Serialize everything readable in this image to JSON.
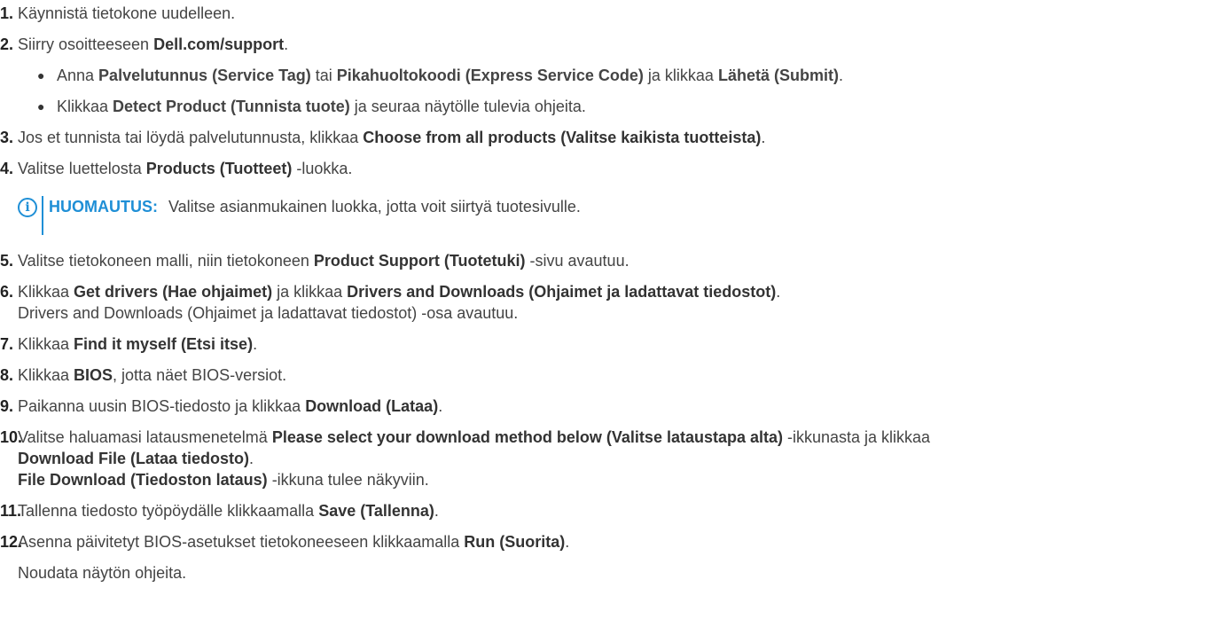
{
  "steps": [
    {
      "n": "1.",
      "parts": [
        {
          "t": "Käynnistä tietokone uudelleen."
        }
      ]
    },
    {
      "n": "2.",
      "parts": [
        {
          "t": "Siirry osoitteeseen "
        },
        {
          "t": "Dell.com/support",
          "b": true
        },
        {
          "t": "."
        }
      ]
    },
    {
      "n": "3.",
      "parts": [
        {
          "t": "Jos et tunnista tai löydä palvelutunnusta, klikkaa "
        },
        {
          "t": "Choose from all products (Valitse kaikista tuotteista)",
          "b": true
        },
        {
          "t": "."
        }
      ]
    },
    {
      "n": "4.",
      "parts": [
        {
          "t": "Valitse luettelosta "
        },
        {
          "t": "Products (Tuotteet)",
          "b": true
        },
        {
          "t": " -luokka."
        }
      ]
    },
    {
      "n": "5.",
      "parts": [
        {
          "t": "Valitse tietokoneen malli, niin tietokoneen "
        },
        {
          "t": "Product Support (Tuotetuki)",
          "b": true
        },
        {
          "t": " -sivu avautuu."
        }
      ]
    },
    {
      "n": "6.",
      "parts": [
        {
          "t": "Klikkaa "
        },
        {
          "t": "Get drivers (Hae ohjaimet)",
          "b": true
        },
        {
          "t": " ja klikkaa "
        },
        {
          "t": "Drivers and Downloads (Ohjaimet ja ladattavat tiedostot)",
          "b": true
        },
        {
          "t": "."
        }
      ]
    },
    {
      "n": "7.",
      "parts": [
        {
          "t": "Klikkaa "
        },
        {
          "t": "Find it myself (Etsi itse)",
          "b": true
        },
        {
          "t": "."
        }
      ]
    },
    {
      "n": "8.",
      "parts": [
        {
          "t": "Klikkaa "
        },
        {
          "t": "BIOS",
          "b": true
        },
        {
          "t": ", jotta näet BIOS-versiot."
        }
      ]
    },
    {
      "n": "9.",
      "parts": [
        {
          "t": "Paikanna uusin BIOS-tiedosto ja klikkaa "
        },
        {
          "t": "Download (Lataa)",
          "b": true
        },
        {
          "t": "."
        }
      ]
    },
    {
      "n": "10.",
      "parts": [
        {
          "t": "Valitse haluamasi latausmenetelmä "
        },
        {
          "t": "Please select your download method below (Valitse lataustapa alta)",
          "b": true
        },
        {
          "t": " -ikkunasta ja klikkaa"
        }
      ]
    },
    {
      "n": "11.",
      "parts": [
        {
          "t": "Tallenna tiedosto työpöydälle klikkaamalla "
        },
        {
          "t": "Save (Tallenna)",
          "b": true
        },
        {
          "t": "."
        }
      ]
    },
    {
      "n": "12.",
      "parts": [
        {
          "t": "Asenna päivitetyt BIOS-asetukset tietokoneeseen klikkaamalla "
        },
        {
          "t": "Run (Suorita)",
          "b": true
        },
        {
          "t": "."
        }
      ]
    }
  ],
  "bullets": [
    {
      "parts": [
        {
          "t": "Anna "
        },
        {
          "t": "Palvelutunnus (Service Tag)",
          "b": true
        },
        {
          "t": " tai "
        },
        {
          "t": "Pikahuoltokoodi (Express Service Code)",
          "b": true
        },
        {
          "t": " ja klikkaa "
        },
        {
          "t": "Lähetä (Submit)",
          "b": true
        },
        {
          "t": "."
        }
      ]
    },
    {
      "parts": [
        {
          "t": "Klikkaa "
        },
        {
          "t": "Detect Product (Tunnista tuote)",
          "b": true
        },
        {
          "t": " ja seuraa näytölle tulevia ohjeita."
        }
      ]
    }
  ],
  "continuations": {
    "step6": "Drivers and Downloads (Ohjaimet ja ladattavat tiedostot) -osa avautuu.",
    "step10_line2": "Download File (Lataa tiedosto)",
    "step10_line2_tail": ".",
    "step10_line3_bold": "File Download (Tiedoston lataus)",
    "step10_line3_tail": " -ikkuna tulee näkyviin.",
    "step12": "Noudata näytön ohjeita."
  },
  "note": {
    "icon": "info-icon",
    "label": "HUOMAUTUS:",
    "text": "Valitse asianmukainen luokka, jotta voit siirtyä tuotesivulle.",
    "accent": "#1f8fd6"
  },
  "bullet_glyph": "●"
}
